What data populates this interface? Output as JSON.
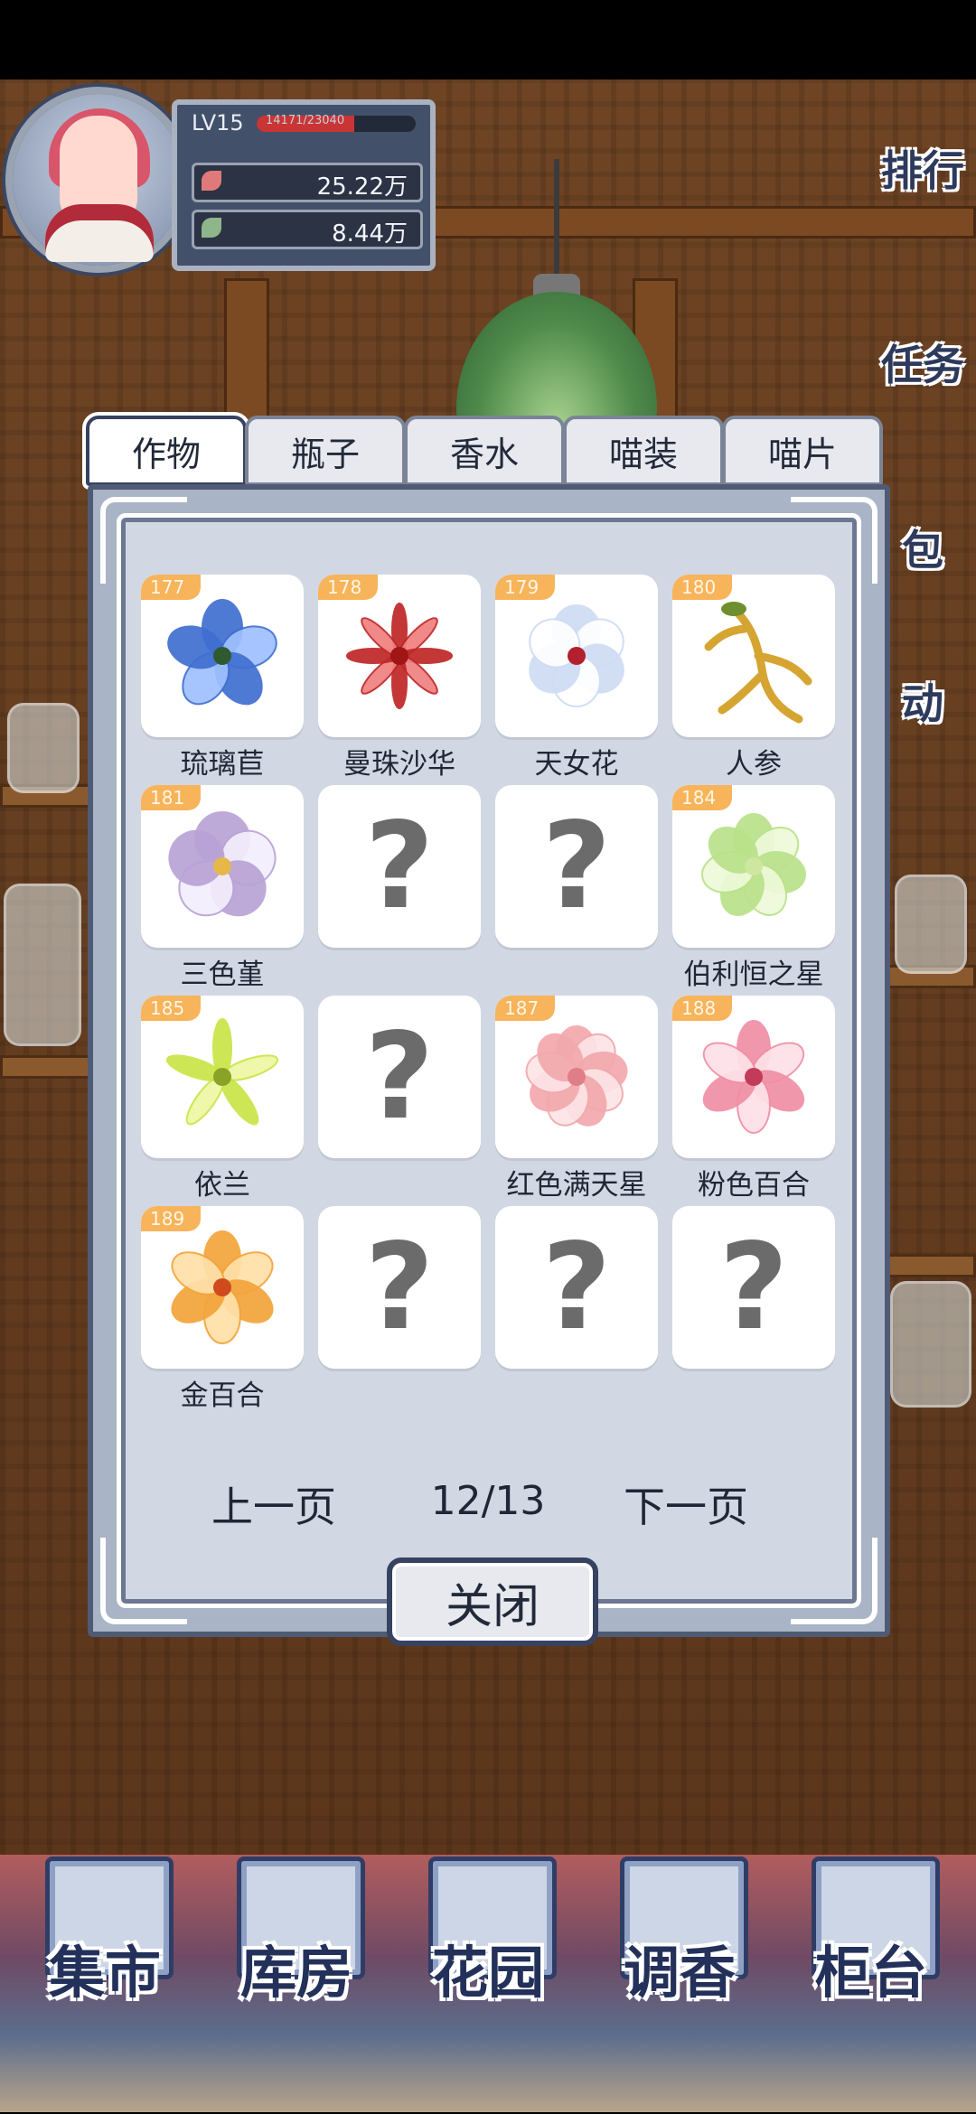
{
  "player": {
    "level": "LV15",
    "xp_text": "14171/23040",
    "xp_fraction": 0.615,
    "currency1": "25.22万",
    "currency2": "8.44万"
  },
  "side_menu": [
    "排行",
    "任务",
    "包",
    "动"
  ],
  "tabs": [
    "作物",
    "瓶子",
    "香水",
    "喵装",
    "喵片"
  ],
  "active_tab": "作物",
  "items": [
    {
      "no": "177",
      "name": "琉璃苣",
      "unlocked": true
    },
    {
      "no": "178",
      "name": "曼珠沙华",
      "unlocked": true
    },
    {
      "no": "179",
      "name": "天女花",
      "unlocked": true
    },
    {
      "no": "180",
      "name": "人参",
      "unlocked": true
    },
    {
      "no": "181",
      "name": "三色堇",
      "unlocked": true
    },
    {
      "no": "",
      "name": "",
      "unlocked": false
    },
    {
      "no": "",
      "name": "",
      "unlocked": false
    },
    {
      "no": "184",
      "name": "伯利恒之星",
      "unlocked": true
    },
    {
      "no": "185",
      "name": "依兰",
      "unlocked": true
    },
    {
      "no": "",
      "name": "",
      "unlocked": false
    },
    {
      "no": "187",
      "name": "红色满天星",
      "unlocked": true
    },
    {
      "no": "188",
      "name": "粉色百合",
      "unlocked": true
    },
    {
      "no": "189",
      "name": "金百合",
      "unlocked": true
    },
    {
      "no": "",
      "name": "",
      "unlocked": false
    },
    {
      "no": "",
      "name": "",
      "unlocked": false
    },
    {
      "no": "",
      "name": "",
      "unlocked": false
    }
  ],
  "unknown_symbol": "?",
  "pager": {
    "prev": "上一页",
    "page": "12/13",
    "next": "下一页"
  },
  "close_label": "关闭",
  "bottom_nav": [
    "集市",
    "库房",
    "花园",
    "调香",
    "柜台"
  ],
  "colors": {
    "badge": "#f7b45b",
    "panel": "#d2d8e3",
    "frame": "#36425f"
  }
}
